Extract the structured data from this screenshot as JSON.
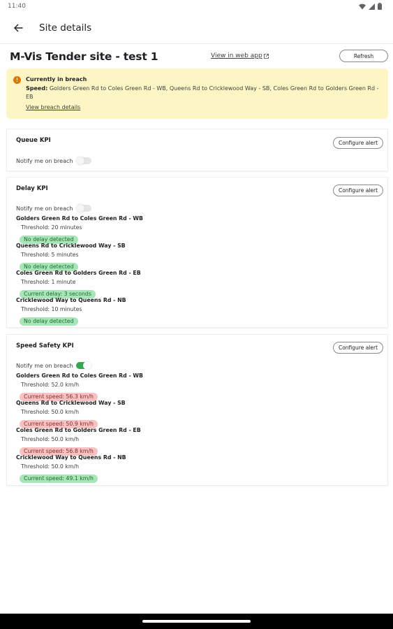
{
  "status_bar": {
    "time": "11:40"
  },
  "app_bar": {
    "title": "Site details"
  },
  "site": {
    "title": "M-Vis Tender site - test 1",
    "web_link": "View in web app",
    "refresh_label": "Refresh"
  },
  "breach": {
    "title": "Currently in breach",
    "label": "Speed:",
    "text": "Golders Green Rd to Coles Green Rd - WB, Queens Rd to Cricklewood Way - SB, Coles Green Rd to Golders Green Rd - EB",
    "link": "View breach details",
    "color": "#fdf6c4"
  },
  "queue_kpi": {
    "title": "Queue KPI",
    "configure_label": "Configure alert",
    "notify_label": "Notify me on breach",
    "notify_on": false
  },
  "delay_kpi": {
    "title": "Delay KPI",
    "configure_label": "Configure alert",
    "notify_label": "Notify me on breach",
    "notify_on": false,
    "routes": [
      {
        "name": "Golders Green Rd to Coles Green Rd - WB",
        "threshold": "Threshold: 20 minutes",
        "status": "No delay detected",
        "ok": true
      },
      {
        "name": "Queens Rd to Cricklewood Way - SB",
        "threshold": "Threshold: 5 minutes",
        "status": "No delay detected",
        "ok": true
      },
      {
        "name": "Coles Green Rd to Golders Green Rd - EB",
        "threshold": "Threshold: 1 minute",
        "status": "Current delay: 3 seconds",
        "ok": true
      },
      {
        "name": "Cricklewood Way to Queens Rd - NB",
        "threshold": "Threshold: 10 minutes",
        "status": "No delay detected",
        "ok": true
      }
    ]
  },
  "speed_kpi": {
    "title": "Speed Safety KPI",
    "configure_label": "Configure alert",
    "notify_label": "Notify me on breach",
    "notify_on": true,
    "routes": [
      {
        "name": "Golders Green Rd to Coles Green Rd - WB",
        "threshold": "Threshold: 52.0 km/h",
        "status": "Current speed: 56.3 km/h",
        "ok": false
      },
      {
        "name": "Queens Rd to Cricklewood Way - SB",
        "threshold": "Threshold: 50.0 km/h",
        "status": "Current speed: 50.9 km/h",
        "ok": false
      },
      {
        "name": "Coles Green Rd to Golders Green Rd - EB",
        "threshold": "Threshold: 50.0 km/h",
        "status": "Current speed: 56.8 km/h",
        "ok": false
      },
      {
        "name": "Cricklewood Way to Queens Rd - NB",
        "threshold": "Threshold: 50.0 km/h",
        "status": "Current speed: 49.1 km/h",
        "ok": true
      }
    ]
  },
  "colors": {
    "ok": "#a8e6b8",
    "bad": "#f8c2c2",
    "accent": "#34a853",
    "warning": "#e37400"
  }
}
